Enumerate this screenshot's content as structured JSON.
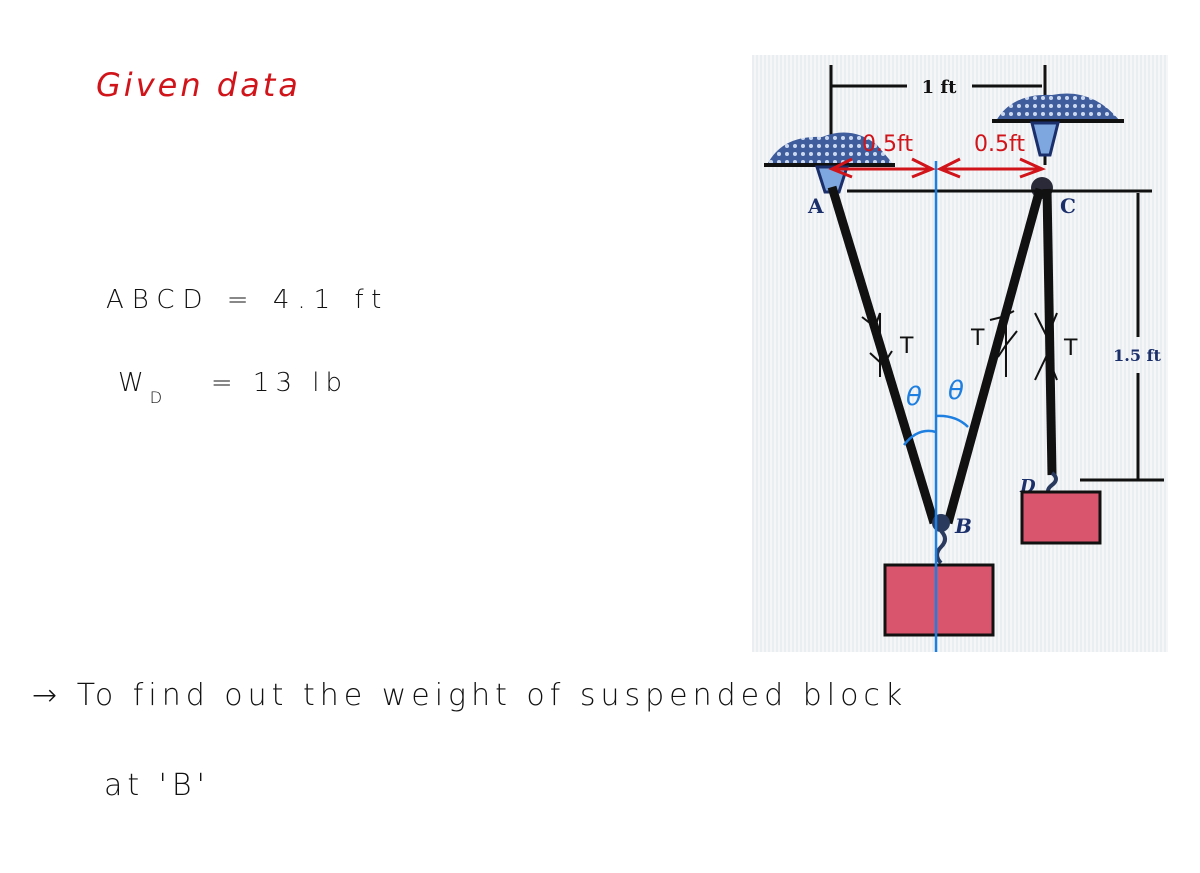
{
  "notes": {
    "heading": "Given data",
    "given": [
      {
        "symbol": "ABCD",
        "equals": "=",
        "value": "4.1",
        "unit": "ft"
      },
      {
        "symbol": "W",
        "subscript": "D",
        "equals": "=",
        "value": "13",
        "unit": "lb"
      }
    ],
    "goal_line_1": "To find out the weight of suspended block",
    "goal_line_2": "at 'B'"
  },
  "diagram": {
    "dimension_top": "1 ft",
    "half_left": "0.5ft",
    "half_right": "0.5ft",
    "dimension_right": "1.5 ft",
    "points": {
      "a": "A",
      "b": "B",
      "c": "C",
      "d": "D"
    },
    "tension_labels": [
      "T",
      "T",
      "T"
    ],
    "angle_labels": [
      "θ",
      "θ"
    ],
    "colors": {
      "annotation_red": "#d0141a",
      "centerline_blue": "#1e7fe0",
      "block_pink": "#d9556e",
      "label_navy": "#1b2f6b"
    }
  }
}
